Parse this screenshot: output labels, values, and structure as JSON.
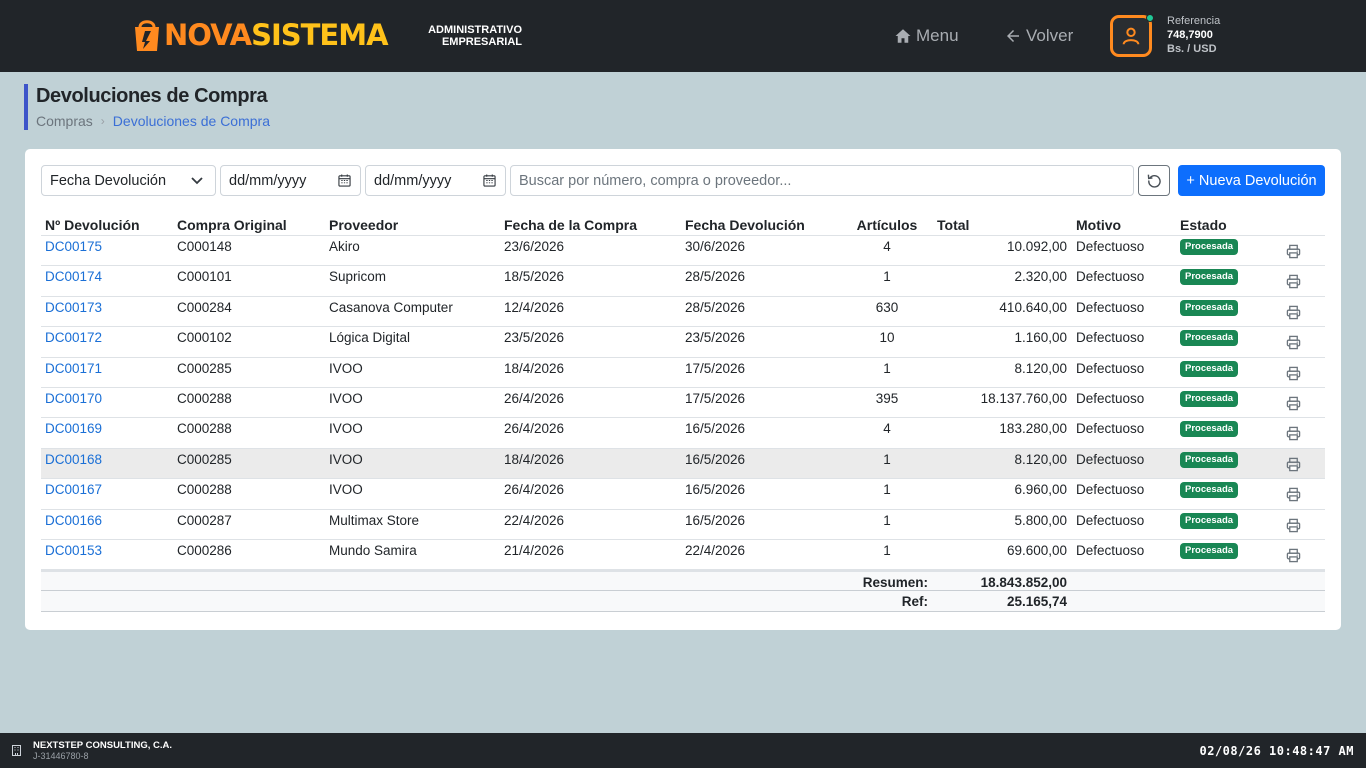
{
  "header": {
    "brand_part1": "NOVA",
    "brand_part2": "SISTEMA",
    "tagline_line1": "ADMINISTRATIVO",
    "tagline_line2": "EMPRESARIAL",
    "menu_label": "Menu",
    "back_label": "Volver",
    "reference_label": "Referencia",
    "reference_value": "748,7900",
    "reference_unit": "Bs. / USD",
    "icons": {
      "menu": "home-icon",
      "back": "arrow-left-icon",
      "user": "user-icon"
    },
    "colors": {
      "brand_orange": "#ff8a1f",
      "brand_yellow": "#ffc21a",
      "online_dot": "#20c997"
    }
  },
  "page": {
    "title": "Devoluciones de Compra",
    "breadcrumb": [
      "Compras",
      "Devoluciones de Compra"
    ]
  },
  "filters": {
    "date_type_selected": "Fecha Devolución",
    "date_from_placeholder": "dd/mm/yyyy",
    "date_to_placeholder": "dd/mm/yyyy",
    "search_placeholder": "Buscar por número, compra o proveedor...",
    "new_button_label": "+ Nueva Devolución"
  },
  "table": {
    "columns": [
      "Nº Devolución",
      "Compra Original",
      "Proveedor",
      "Fecha de la Compra",
      "Fecha Devolución",
      "Artículos",
      "Total",
      "Motivo",
      "Estado"
    ],
    "rows": [
      {
        "id": "DC00175",
        "compra": "C000148",
        "proveedor": "Akiro",
        "fecha_compra": "23/6/2026",
        "fecha_dev": "30/6/2026",
        "articulos": "4",
        "total": "10.092,00",
        "motivo": "Defectuoso",
        "estado": "Procesada"
      },
      {
        "id": "DC00174",
        "compra": "C000101",
        "proveedor": "Supricom",
        "fecha_compra": "18/5/2026",
        "fecha_dev": "28/5/2026",
        "articulos": "1",
        "total": "2.320,00",
        "motivo": "Defectuoso",
        "estado": "Procesada"
      },
      {
        "id": "DC00173",
        "compra": "C000284",
        "proveedor": "Casanova Computer",
        "fecha_compra": "12/4/2026",
        "fecha_dev": "28/5/2026",
        "articulos": "630",
        "total": "410.640,00",
        "motivo": "Defectuoso",
        "estado": "Procesada"
      },
      {
        "id": "DC00172",
        "compra": "C000102",
        "proveedor": "Lógica Digital",
        "fecha_compra": "23/5/2026",
        "fecha_dev": "23/5/2026",
        "articulos": "10",
        "total": "1.160,00",
        "motivo": "Defectuoso",
        "estado": "Procesada"
      },
      {
        "id": "DC00171",
        "compra": "C000285",
        "proveedor": "IVOO",
        "fecha_compra": "18/4/2026",
        "fecha_dev": "17/5/2026",
        "articulos": "1",
        "total": "8.120,00",
        "motivo": "Defectuoso",
        "estado": "Procesada"
      },
      {
        "id": "DC00170",
        "compra": "C000288",
        "proveedor": "IVOO",
        "fecha_compra": "26/4/2026",
        "fecha_dev": "17/5/2026",
        "articulos": "395",
        "total": "18.137.760,00",
        "motivo": "Defectuoso",
        "estado": "Procesada"
      },
      {
        "id": "DC00169",
        "compra": "C000288",
        "proveedor": "IVOO",
        "fecha_compra": "26/4/2026",
        "fecha_dev": "16/5/2026",
        "articulos": "4",
        "total": "183.280,00",
        "motivo": "Defectuoso",
        "estado": "Procesada"
      },
      {
        "id": "DC00168",
        "compra": "C000285",
        "proveedor": "IVOO",
        "fecha_compra": "18/4/2026",
        "fecha_dev": "16/5/2026",
        "articulos": "1",
        "total": "8.120,00",
        "motivo": "Defectuoso",
        "estado": "Procesada"
      },
      {
        "id": "DC00167",
        "compra": "C000288",
        "proveedor": "IVOO",
        "fecha_compra": "26/4/2026",
        "fecha_dev": "16/5/2026",
        "articulos": "1",
        "total": "6.960,00",
        "motivo": "Defectuoso",
        "estado": "Procesada"
      },
      {
        "id": "DC00166",
        "compra": "C000287",
        "proveedor": "Multimax Store",
        "fecha_compra": "22/4/2026",
        "fecha_dev": "16/5/2026",
        "articulos": "1",
        "total": "5.800,00",
        "motivo": "Defectuoso",
        "estado": "Procesada"
      },
      {
        "id": "DC00153",
        "compra": "C000286",
        "proveedor": "Mundo Samira",
        "fecha_compra": "21/4/2026",
        "fecha_dev": "22/4/2026",
        "articulos": "1",
        "total": "69.600,00",
        "motivo": "Defectuoso",
        "estado": "Procesada"
      }
    ],
    "summary": {
      "total_label": "Resumen:",
      "total_value": "18.843.852,00",
      "ref_label": "Ref:",
      "ref_value": "25.165,74"
    },
    "badge_color": "#198754",
    "link_color": "#1a6fd6"
  },
  "footer": {
    "company": "NEXTSTEP CONSULTING, C.A.",
    "rif": "J-31446780-8",
    "clock": "02/08/26 10:48:47 AM"
  }
}
